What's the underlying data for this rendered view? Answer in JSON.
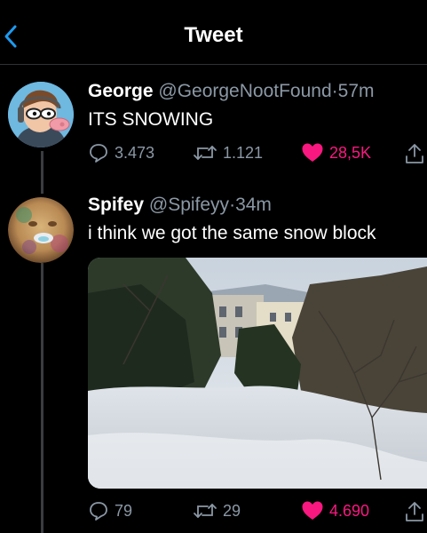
{
  "header": {
    "title": "Tweet"
  },
  "tweets": [
    {
      "name": "George",
      "handle": "@GeorgeNootFound",
      "separator": "·",
      "time": "57m",
      "text": "ITS SNOWING",
      "replies": "3.473",
      "retweets": "1.121",
      "likes": "28,5K",
      "liked": true
    },
    {
      "name": "Spifey",
      "handle": "@Spifeyy",
      "separator": "·",
      "time": "34m",
      "text": "i think we got the same snow block",
      "replies": "79",
      "retweets": "29",
      "likes": "4.690",
      "liked": true
    }
  ],
  "colors": {
    "like": "#f91880",
    "accent": "#1d9bf0",
    "muted": "#8b98a5"
  },
  "icons": [
    "back-icon",
    "reply-icon",
    "retweet-icon",
    "heart-icon",
    "share-icon"
  ]
}
